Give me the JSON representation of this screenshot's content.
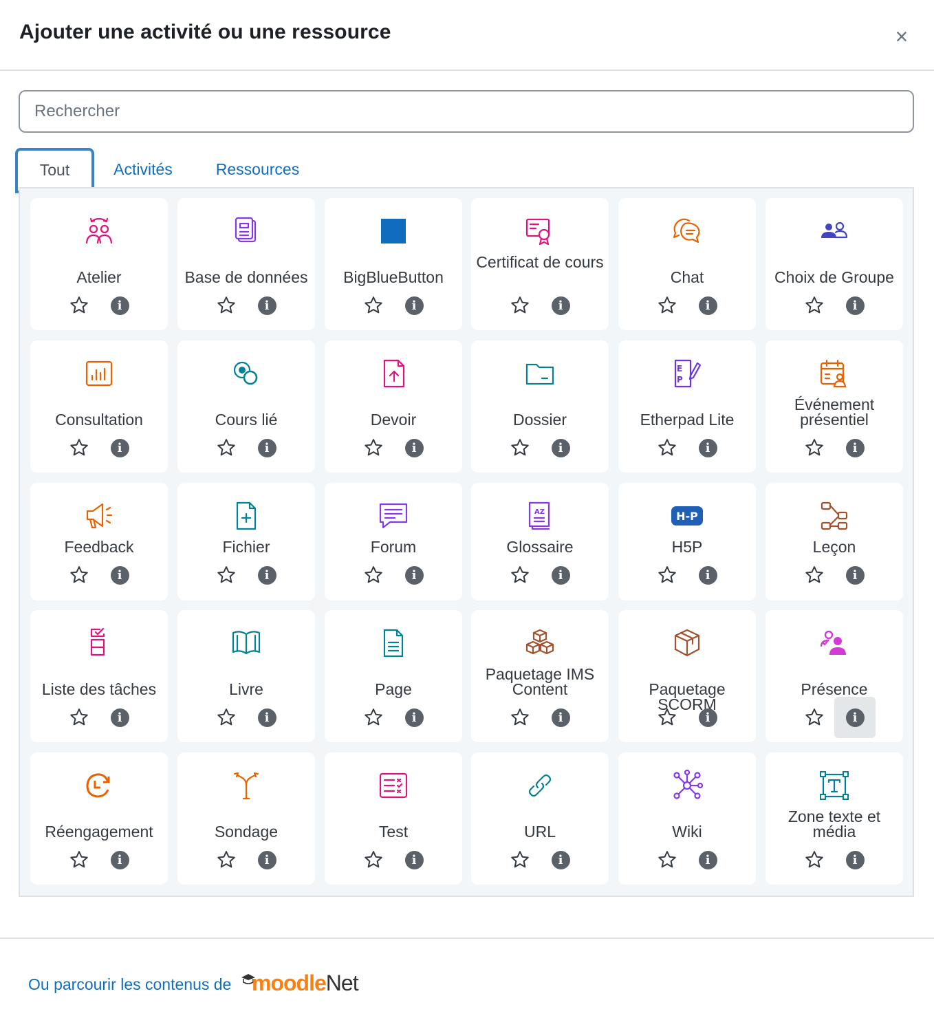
{
  "modal": {
    "title": "Ajouter une activité ou une ressource",
    "close_symbol": "×"
  },
  "search": {
    "placeholder": "Rechercher"
  },
  "tabs": [
    {
      "label": "Tout"
    },
    {
      "label": "Activités"
    },
    {
      "label": "Ressources"
    }
  ],
  "items": [
    {
      "label": "Atelier",
      "icon": "workshop-icon",
      "color": "#e0137b"
    },
    {
      "label": "Base de données",
      "icon": "database-icon",
      "color": "#8338ec"
    },
    {
      "label": "BigBlueButton",
      "icon": "bigbluebutton-icon",
      "color": "#0f6cbf"
    },
    {
      "label": "Certificat de cours",
      "icon": "certificate-icon",
      "color": "#e0137b"
    },
    {
      "label": "Chat",
      "icon": "chat-icon",
      "color": "#eb6100"
    },
    {
      "label": "Choix de Groupe",
      "icon": "group-choice-icon",
      "color": "#4343c8"
    },
    {
      "label": "Consultation",
      "icon": "survey-icon",
      "color": "#eb6100"
    },
    {
      "label": "Cours lié",
      "icon": "linked-course-icon",
      "color": "#008196"
    },
    {
      "label": "Devoir",
      "icon": "assignment-icon",
      "color": "#e0137b"
    },
    {
      "label": "Dossier",
      "icon": "folder-icon",
      "color": "#008196"
    },
    {
      "label": "Etherpad Lite",
      "icon": "etherpad-icon",
      "color": "#6b35e3"
    },
    {
      "label": "Événement présentiel",
      "icon": "facetoface-icon",
      "color": "#eb6100"
    },
    {
      "label": "Feedback",
      "icon": "megaphone-icon",
      "color": "#eb6100"
    },
    {
      "label": "Fichier",
      "icon": "file-icon",
      "color": "#008196"
    },
    {
      "label": "Forum",
      "icon": "forum-icon",
      "color": "#8338ec"
    },
    {
      "label": "Glossaire",
      "icon": "glossary-icon",
      "color": "#8338ec"
    },
    {
      "label": "H5P",
      "icon": "h5p-icon",
      "color": "#1f5fb4"
    },
    {
      "label": "Leçon",
      "icon": "lesson-icon",
      "color": "#a0522d"
    },
    {
      "label": "Liste des tâches",
      "icon": "checklist-icon",
      "color": "#e0137b"
    },
    {
      "label": "Livre",
      "icon": "book-icon",
      "color": "#008196"
    },
    {
      "label": "Page",
      "icon": "page-icon",
      "color": "#008196"
    },
    {
      "label": "Paquetage IMS Content",
      "icon": "ims-package-icon",
      "color": "#a0522d"
    },
    {
      "label": "Paquetage SCORM",
      "icon": "scorm-package-icon",
      "color": "#a0522d"
    },
    {
      "label": "Présence",
      "icon": "attendance-icon",
      "color": "#d63ad6"
    },
    {
      "label": "Réengagement",
      "icon": "reengagement-icon",
      "color": "#eb6100"
    },
    {
      "label": "Sondage",
      "icon": "choice-icon",
      "color": "#eb6100"
    },
    {
      "label": "Test",
      "icon": "quiz-icon",
      "color": "#e0137b"
    },
    {
      "label": "URL",
      "icon": "link-icon",
      "color": "#008196"
    },
    {
      "label": "Wiki",
      "icon": "wiki-icon",
      "color": "#8338ec"
    },
    {
      "label": "Zone texte et média",
      "icon": "text-media-icon",
      "color": "#008196"
    }
  ],
  "footer": {
    "link_text": "Ou parcourir les contenus de",
    "brand_part1": "moodle",
    "brand_part2": "Net"
  }
}
